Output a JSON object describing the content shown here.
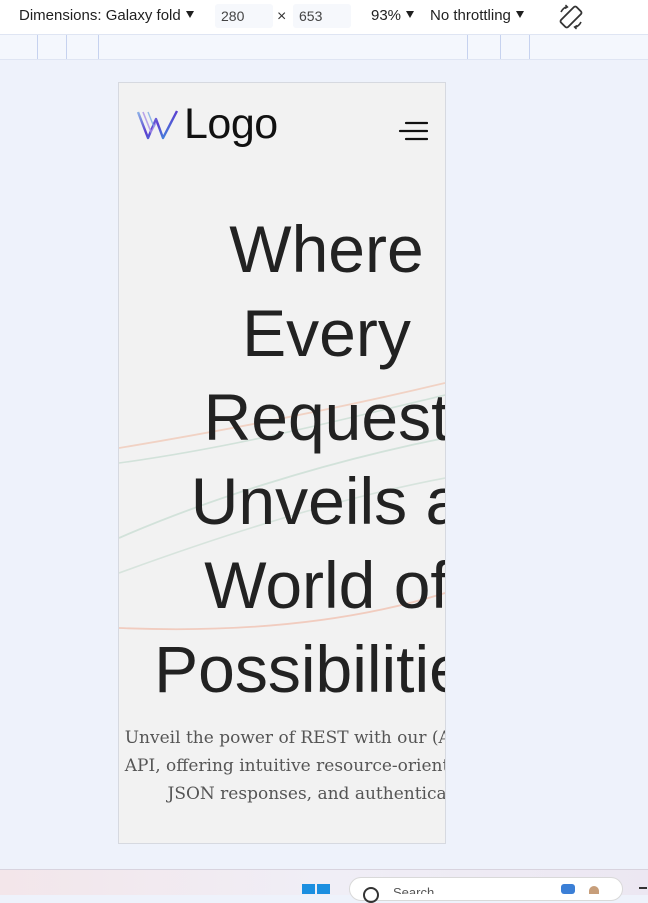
{
  "devtools": {
    "dimensions_label": "Dimensions: Galaxy fold",
    "width_value": "280",
    "times_symbol": "×",
    "height_value": "653",
    "zoom_label": "93%",
    "throttle_label": "No throttling",
    "rotate_icon": "rotate-icon"
  },
  "page": {
    "logo_text": "Logo",
    "logo_icon": "logo-mark-icon",
    "menu_icon": "hamburger-icon",
    "hero_title": "Where\nEvery\nRequest\nUnveils a\nWorld of\nPossibilities",
    "hero_subtitle": "Unveil the power of REST with our (API name) API, offering intuitive resource-oriented URLs, JSON responses, and authentication."
  },
  "taskbar": {
    "start_icon": "windows-start-icon",
    "search_placeholder": "Search"
  },
  "colors": {
    "toolbar_bg": "#ffffff",
    "canvas_bg": "#eef2fb",
    "viewport_bg": "#f2f2f2",
    "heading": "#222222",
    "subtitle": "#555555",
    "logo_gradient": [
      "#5b3fd0",
      "#3aa0e0",
      "#8fb7e8"
    ]
  }
}
